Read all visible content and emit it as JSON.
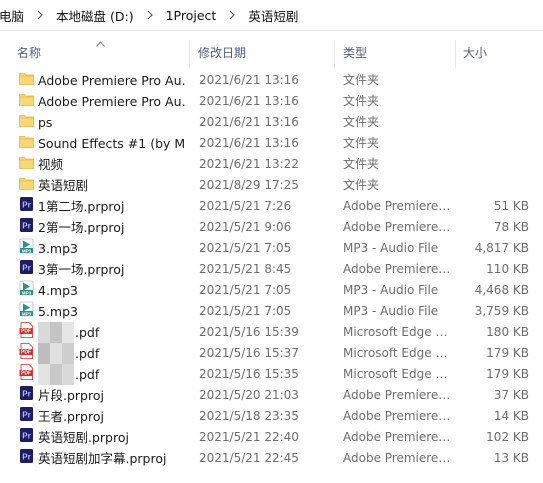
{
  "breadcrumb": [
    "电脑",
    "本地磁盘 (D:)",
    "1Project",
    "英语短剧"
  ],
  "columns": {
    "name": "名称",
    "date": "修改日期",
    "type": "类型",
    "size": "大小"
  },
  "colors": {
    "folder": "#f8d775",
    "folder_dark": "#e0b640",
    "pr": "#1c1d63",
    "pr_text": "#b6b6ff",
    "mp3": "#2f8f8a",
    "pdf": "#c9302c"
  },
  "files": [
    {
      "icon": "folder",
      "name": "Adobe Premiere Pro Au…",
      "date": "2021/6/21 13:16",
      "type": "文件夹",
      "size": ""
    },
    {
      "icon": "folder",
      "name": "Adobe Premiere Pro Au…",
      "date": "2021/6/21 13:16",
      "type": "文件夹",
      "size": ""
    },
    {
      "icon": "folder",
      "name": "ps",
      "date": "2021/6/21 13:16",
      "type": "文件夹",
      "size": ""
    },
    {
      "icon": "folder",
      "name": "Sound Effects #1 (by M…",
      "date": "2021/6/21 13:16",
      "type": "文件夹",
      "size": ""
    },
    {
      "icon": "folder",
      "name": "视频",
      "date": "2021/6/21 13:22",
      "type": "文件夹",
      "size": ""
    },
    {
      "icon": "folder",
      "name": "英语短剧",
      "date": "2021/8/29 17:25",
      "type": "文件夹",
      "size": ""
    },
    {
      "icon": "prproj",
      "name": "1第二场.prproj",
      "date": "2021/5/21 7:26",
      "type": "Adobe Premiere…",
      "size": "51 KB"
    },
    {
      "icon": "prproj",
      "name": "2第一场.prproj",
      "date": "2021/5/21 9:06",
      "type": "Adobe Premiere…",
      "size": "78 KB"
    },
    {
      "icon": "mp3",
      "name": "3.mp3",
      "date": "2021/5/21 7:05",
      "type": "MP3 - Audio File",
      "size": "4,817 KB"
    },
    {
      "icon": "prproj",
      "name": "3第一场.prproj",
      "date": "2021/5/21 8:45",
      "type": "Adobe Premiere…",
      "size": "110 KB"
    },
    {
      "icon": "mp3",
      "name": "4.mp3",
      "date": "2021/5/21 7:05",
      "type": "MP3 - Audio File",
      "size": "4,468 KB"
    },
    {
      "icon": "mp3",
      "name": "5.mp3",
      "date": "2021/5/21 7:05",
      "type": "MP3 - Audio File",
      "size": "3,759 KB"
    },
    {
      "icon": "pdf",
      "name": ".pdf",
      "date": "2021/5/16 15:39",
      "type": "Microsoft Edge …",
      "size": "180 KB",
      "blurred": true
    },
    {
      "icon": "pdf",
      "name": ".pdf",
      "date": "2021/5/16 15:37",
      "type": "Microsoft Edge …",
      "size": "179 KB",
      "blurred": true
    },
    {
      "icon": "pdf",
      "name": ".pdf",
      "date": "2021/5/16 15:35",
      "type": "Microsoft Edge …",
      "size": "179 KB",
      "blurred": true
    },
    {
      "icon": "prproj",
      "name": "片段.prproj",
      "date": "2021/5/20 21:03",
      "type": "Adobe Premiere…",
      "size": "37 KB"
    },
    {
      "icon": "prproj",
      "name": "王者.prproj",
      "date": "2021/5/18 23:35",
      "type": "Adobe Premiere…",
      "size": "14 KB"
    },
    {
      "icon": "prproj",
      "name": "英语短剧.prproj",
      "date": "2021/5/21 22:40",
      "type": "Adobe Premiere…",
      "size": "102 KB"
    },
    {
      "icon": "prproj",
      "name": "英语短剧加字幕.prproj",
      "date": "2021/5/21 22:45",
      "type": "Adobe Premiere…",
      "size": "13 KB"
    }
  ]
}
